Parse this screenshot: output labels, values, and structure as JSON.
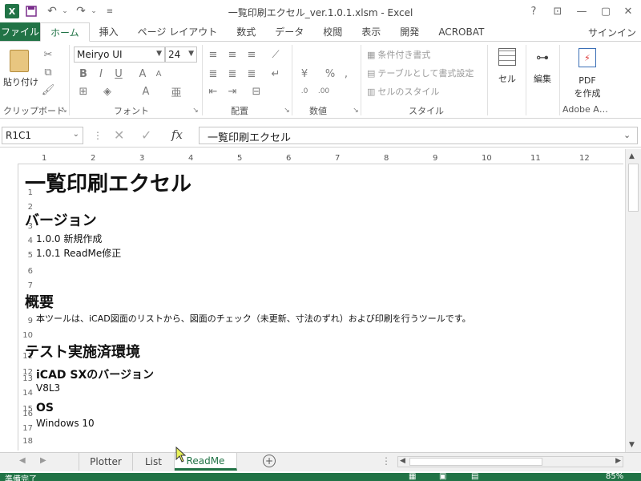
{
  "window": {
    "title": "一覧印刷エクセル_ver.1.0.1.xlsm - Excel",
    "help": "?",
    "minimize": "—",
    "restore": "▢",
    "close": "✕"
  },
  "tabs": {
    "file": "ファイル",
    "items": [
      "ホーム",
      "挿入",
      "ページ レイアウト",
      "数式",
      "データ",
      "校閲",
      "表示",
      "開発",
      "ACROBAT"
    ],
    "signin": "サインイン"
  },
  "ribbon": {
    "paste_label": "貼り付け",
    "font_name": "Meiryo UI",
    "font_size": "24",
    "group_labels": [
      "クリップボード",
      "フォント",
      "配置",
      "数値",
      "スタイル",
      "Adobe A…"
    ],
    "styles": [
      "条件付き書式",
      "テーブルとして書式設定",
      "セルのスタイル"
    ],
    "cell_label": "セル",
    "edit_label": "編集",
    "pdf_label_1": "PDF",
    "pdf_label_2": "を作成",
    "bold": "B",
    "italic": "I",
    "underline": "U",
    "percent": "%"
  },
  "formula_bar": {
    "name_box": "R1C1",
    "fx": "fx",
    "content": "一覧印刷エクセル"
  },
  "ruler": [
    "1",
    "2",
    "3",
    "4",
    "5",
    "6",
    "7",
    "8",
    "9",
    "10",
    "11",
    "12"
  ],
  "sheet_rows": [
    {
      "n": "1",
      "text": "一覧印刷エクセル"
    },
    {
      "n": "2",
      "text": ""
    },
    {
      "n": "3",
      "text": "バージョン"
    },
    {
      "n": "4",
      "text": "1.0.0 新規作成"
    },
    {
      "n": "5",
      "text": "1.0.1 ReadMe修正"
    },
    {
      "n": "6",
      "text": ""
    },
    {
      "n": "7",
      "text": ""
    },
    {
      "n": "8",
      "text": "概要"
    },
    {
      "n": "9",
      "text": "本ツールは、iCAD図面のリストから、図面のチェック（未更新、寸法のずれ）および印刷を行うツールです。"
    },
    {
      "n": "10",
      "text": ""
    },
    {
      "n": "11",
      "text": "テスト実施済環境"
    },
    {
      "n": "12",
      "text": ""
    },
    {
      "n": "13",
      "text": "iCAD SXのバージョン"
    },
    {
      "n": "14",
      "text": "V8L3"
    },
    {
      "n": "15",
      "text": ""
    },
    {
      "n": "16",
      "text": "OS"
    },
    {
      "n": "17",
      "text": "Windows 10"
    },
    {
      "n": "18",
      "text": ""
    }
  ],
  "sheet_tabs": [
    "Plotter",
    "List",
    "ReadMe"
  ],
  "status": {
    "ready": "準備完了",
    "zoom": "85%"
  },
  "colors": {
    "accent": "#217346"
  }
}
